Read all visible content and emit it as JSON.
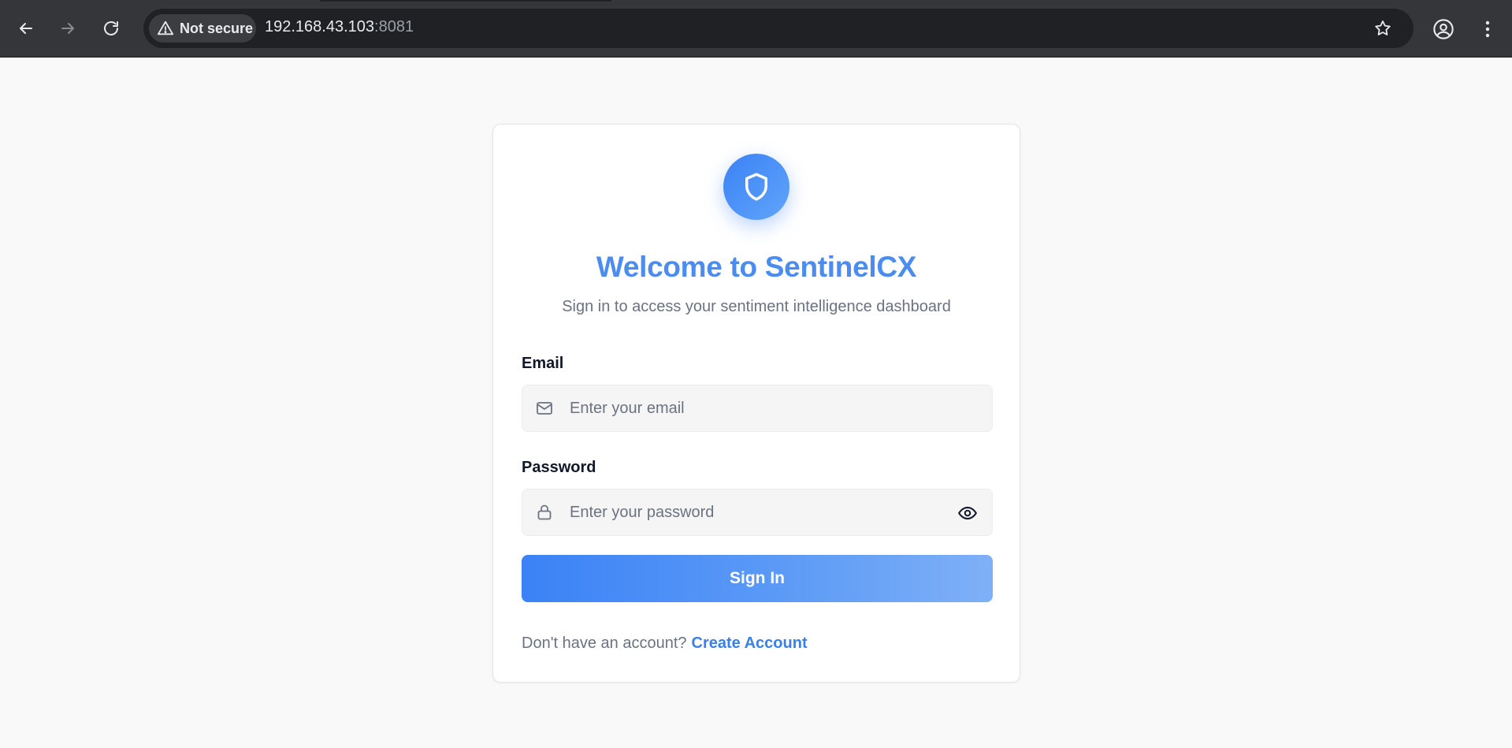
{
  "browser": {
    "security_label": "Not secure",
    "url_host": "192.168.43.103",
    "url_port": ":8081"
  },
  "login": {
    "title": "Welcome to SentinelCX",
    "subtitle": "Sign in to access your sentiment intelligence dashboard",
    "email_label": "Email",
    "email_placeholder": "Enter your email",
    "password_label": "Password",
    "password_placeholder": "Enter your password",
    "signin_label": "Sign In",
    "footer_prompt": "Don't have an account?",
    "create_account_label": "Create Account"
  },
  "icons": {
    "logo": "shield-icon",
    "email": "mail-icon",
    "password": "lock-icon",
    "reveal": "eye-icon"
  },
  "colors": {
    "accent": "#3b82f6",
    "title": "#4a8cf0",
    "link": "#3b7fe8"
  }
}
